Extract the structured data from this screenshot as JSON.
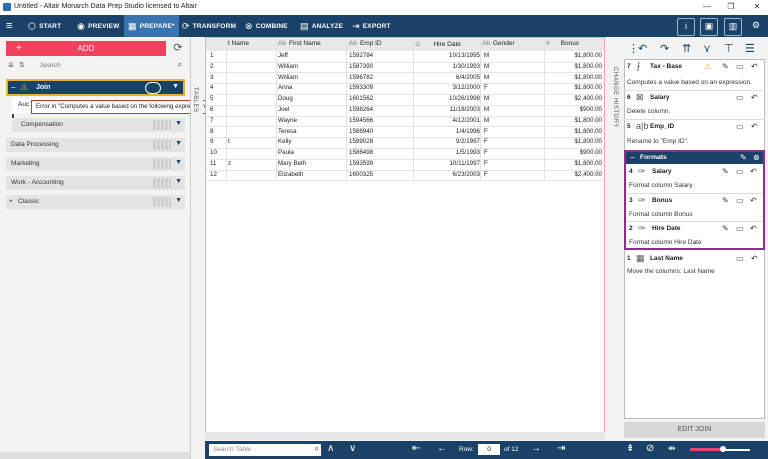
{
  "window": {
    "title": "Untitled - Altair Monarch Data Prep Studio licensed to Altair",
    "controls": [
      "—",
      "❐",
      "✕"
    ]
  },
  "ribbon": {
    "tabs": [
      {
        "label": "START",
        "icon": "cube-icon"
      },
      {
        "label": "PREVIEW",
        "icon": "eye-icon"
      },
      {
        "label": "PREPARE*",
        "icon": "table-icon",
        "active": true
      },
      {
        "label": "TRANSFORM",
        "icon": "refresh-icon"
      },
      {
        "label": "COMBINE",
        "icon": "link-icon"
      },
      {
        "label": "ANALYZE",
        "icon": "chart-icon"
      },
      {
        "label": "EXPORT",
        "icon": "export-icon"
      }
    ]
  },
  "left_panel": {
    "add_label": "ADD",
    "search_placeholder": "Search",
    "join_group": "Join",
    "join_item_prefix": "Auc",
    "tooltip": "Error in \"Computes a value based on the following expression: Salary*0.15\": Invalid term.",
    "groups": [
      {
        "label": "Compensation"
      },
      {
        "label": "Data Processing"
      },
      {
        "label": "Marketing"
      },
      {
        "label": "Work - Accounting"
      },
      {
        "label": "Classic",
        "plus": "+"
      }
    ]
  },
  "tables_label": "TABLES",
  "grid": {
    "columns": [
      {
        "label": "t Name",
        "type": ""
      },
      {
        "label": "First Name",
        "type": "Ab"
      },
      {
        "label": "Emp ID",
        "type": "Ab"
      },
      {
        "label": "Hire Date",
        "type": "⊙"
      },
      {
        "label": "Gender",
        "type": "Ab"
      },
      {
        "label": "Bonus",
        "type": "#"
      }
    ],
    "rows": [
      {
        "n": "1",
        "p": "",
        "first": "Jeff",
        "emp": "1592784",
        "hire": "10/13/1995",
        "gender": "M",
        "bonus": "$1,800.00"
      },
      {
        "n": "2",
        "p": "",
        "first": "William",
        "emp": "1587390",
        "hire": "1/30/1993",
        "gender": "M",
        "bonus": "$1,800.00"
      },
      {
        "n": "3",
        "p": "",
        "first": "William",
        "emp": "1596782",
        "hire": "6/4/2005",
        "gender": "M",
        "bonus": "$1,800.00"
      },
      {
        "n": "4",
        "p": "",
        "first": "Anna",
        "emp": "1593309",
        "hire": "3/12/2000",
        "gender": "F",
        "bonus": "$1,800.00"
      },
      {
        "n": "5",
        "p": "",
        "first": "Doug",
        "emp": "1601562",
        "hire": "10/26/1998",
        "gender": "M",
        "bonus": "$2,400.00"
      },
      {
        "n": "6",
        "p": "",
        "first": "Joel",
        "emp": "1598264",
        "hire": "11/18/2003",
        "gender": "M",
        "bonus": "$900.00"
      },
      {
        "n": "7",
        "p": "",
        "first": "Wayne",
        "emp": "1594566",
        "hire": "4/12/2001",
        "gender": "M",
        "bonus": "$1,800.00"
      },
      {
        "n": "8",
        "p": "",
        "first": "Teresa",
        "emp": "1588940",
        "hire": "1/4/1996",
        "gender": "F",
        "bonus": "$1,800.00"
      },
      {
        "n": "9",
        "p": "t",
        "first": "Kelly",
        "emp": "1599028",
        "hire": "9/2/1997",
        "gender": "F",
        "bonus": "$1,800.00"
      },
      {
        "n": "10",
        "p": "",
        "first": "Paula",
        "emp": "1586498",
        "hire": "1/5/1993",
        "gender": "F",
        "bonus": "$900.00"
      },
      {
        "n": "11",
        "p": "z",
        "first": "Mary Beth",
        "emp": "1593599",
        "hire": "10/11/1997",
        "gender": "F",
        "bonus": "$1,800.00"
      },
      {
        "n": "12",
        "p": "",
        "first": "Elizabeth",
        "emp": "1600325",
        "hire": "6/23/2003",
        "gender": "F",
        "bonus": "$2,400.00"
      }
    ]
  },
  "bottom_nav": {
    "search_placeholder": "Search Table",
    "row_label": "Row:",
    "row_value": "0",
    "of_label": "of 12"
  },
  "history": {
    "label": "CHANGE HISTORY",
    "items": [
      {
        "num": "7",
        "title": "Tax - Base",
        "desc": "Computes a value based on an expression.",
        "icon": "function-icon"
      },
      {
        "num": "6",
        "title": "Salary",
        "desc": "Delete column.",
        "icon": "delete-column-icon"
      },
      {
        "num": "5",
        "title": "Emp_ID",
        "desc": "Rename to \"Emp ID\".",
        "icon": "rename-icon"
      }
    ],
    "formats": {
      "label": "Formats",
      "items": [
        {
          "num": "4",
          "title": "Salary",
          "desc": "Format column Salary"
        },
        {
          "num": "3",
          "title": "Bonus",
          "desc": "Format column Bonus"
        },
        {
          "num": "2",
          "title": "Hire Date",
          "desc": "Format column Hire Date"
        }
      ]
    },
    "last": {
      "num": "1",
      "title": "Last Name",
      "desc": "Move the columns: Last Name"
    },
    "edit_join": "EDIT JOIN"
  },
  "zoom_fraction": 0.55,
  "colors": {
    "ribbon": "#1a4268",
    "accent": "#f0425e",
    "formats_border": "#8e2d8e",
    "warning": "#e3b334"
  }
}
